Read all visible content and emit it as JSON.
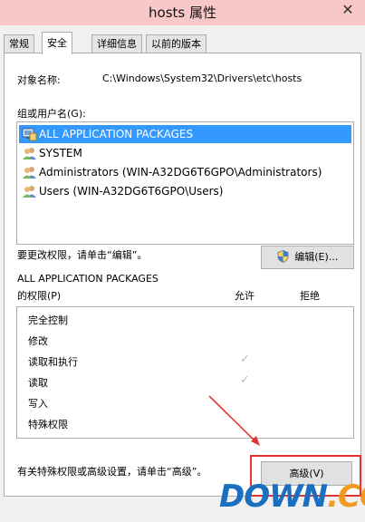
{
  "window": {
    "title": "hosts 属性",
    "close_glyph": "✕"
  },
  "tabs": [
    {
      "label": "常规",
      "active": false
    },
    {
      "label": "安全",
      "active": true
    },
    {
      "label": "详细信息",
      "active": false
    },
    {
      "label": "以前的版本",
      "active": false
    }
  ],
  "security": {
    "object_label": "对象名称:",
    "object_value": "C:\\Windows\\System32\\Drivers\\etc\\hosts",
    "groups_label": "组或用户名(G):",
    "groups": [
      {
        "name": "ALL APPLICATION PACKAGES",
        "icon": "app-packages-icon",
        "selected": true
      },
      {
        "name": "SYSTEM",
        "icon": "users-icon",
        "selected": false
      },
      {
        "name": "Administrators (WIN-A32DG6T6GPO\\Administrators)",
        "icon": "users-icon",
        "selected": false
      },
      {
        "name": "Users (WIN-A32DG6T6GPO\\Users)",
        "icon": "users-icon",
        "selected": false
      }
    ],
    "change_hint": "要更改权限，请单击“编辑”。",
    "edit_button": "编辑(E)...",
    "perm_for_line1": "ALL APPLICATION PACKAGES",
    "perm_for_line2": "的权限(P)",
    "allow_header": "允许",
    "deny_header": "拒绝",
    "permissions": [
      {
        "name": "完全控制",
        "allow": false
      },
      {
        "name": "修改",
        "allow": false
      },
      {
        "name": "读取和执行",
        "allow": true
      },
      {
        "name": "读取",
        "allow": true
      },
      {
        "name": "写入",
        "allow": false
      },
      {
        "name": "特殊权限",
        "allow": false
      }
    ],
    "check_glyph": "✓",
    "advanced_hint": "有关特殊权限或高级设置，请单击“高级”。",
    "advanced_button": "高级(V)"
  },
  "watermark": {
    "part1": "DOWN",
    "part2": ".CC"
  },
  "colors": {
    "selected": "#3399ff",
    "annotation": "#e53333",
    "watermark_blue": "#1a6fc0",
    "watermark_orange": "#f29a1f"
  }
}
